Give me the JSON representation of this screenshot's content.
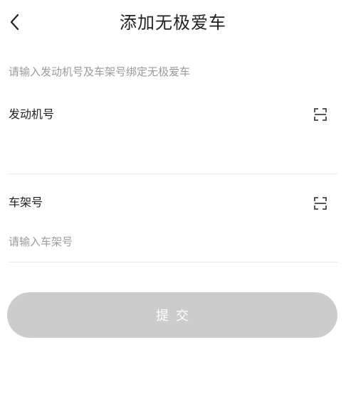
{
  "header": {
    "title": "添加无极爱车",
    "back_icon": "chevron-left-icon"
  },
  "form": {
    "hint": "请输入发动机号及车架号绑定无极爱车",
    "engine": {
      "label": "发动机号",
      "value": "",
      "placeholder": "",
      "scan_icon": "scan-icon"
    },
    "frame": {
      "label": "车架号",
      "value": "",
      "placeholder": "请输入车架号",
      "scan_icon": "scan-icon"
    },
    "submit_label": "提交"
  },
  "colors": {
    "text": "#222222",
    "hint": "#9a9a9a",
    "divider": "#ebebeb",
    "button_disabled": "#cccccc",
    "button_text": "#ffffff"
  }
}
